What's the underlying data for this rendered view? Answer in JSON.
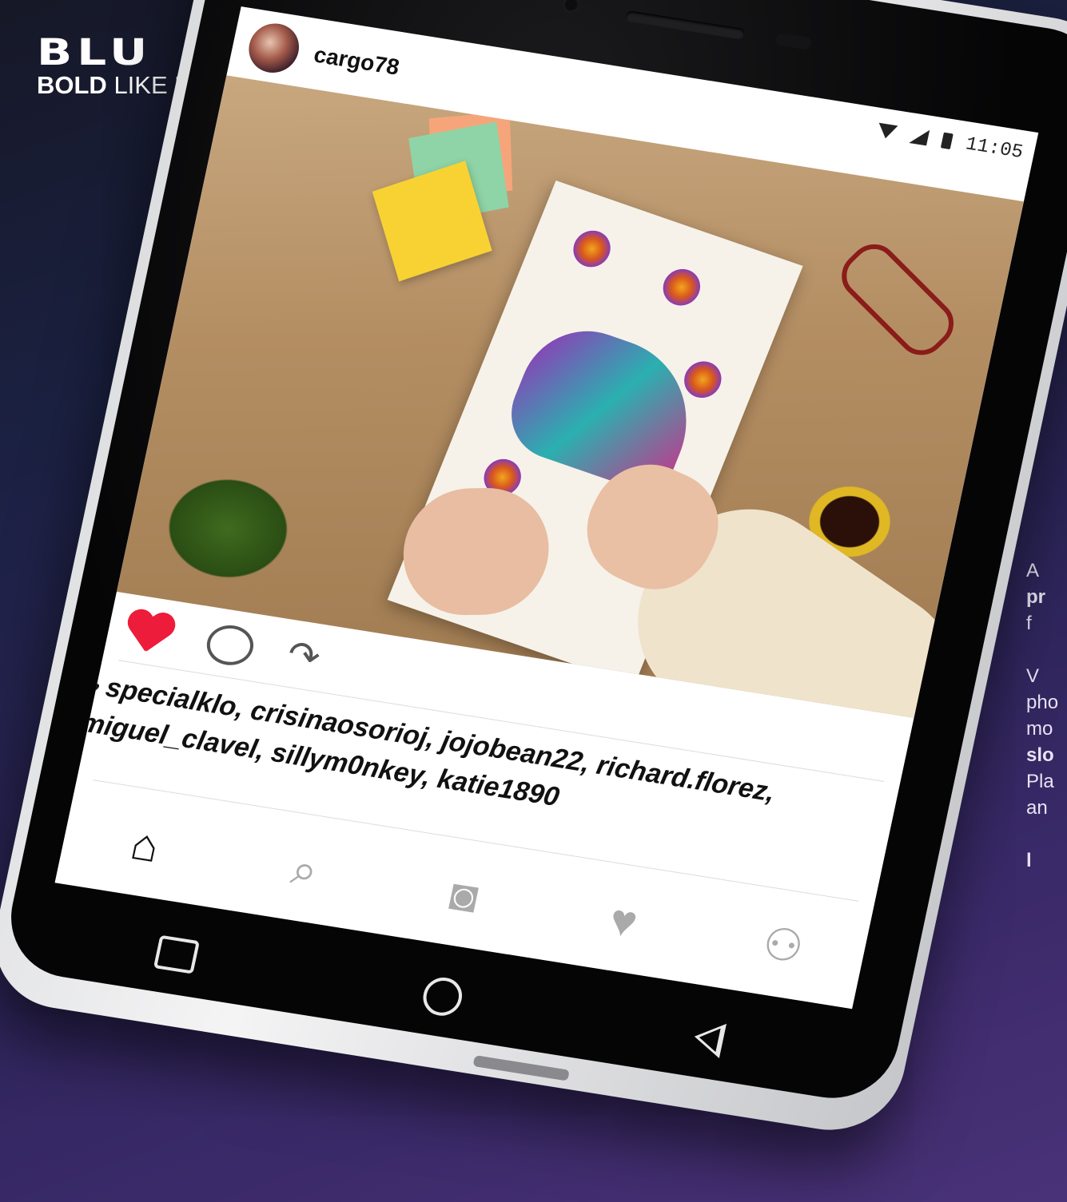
{
  "brand": {
    "name": "BLU",
    "tagline_bold": "BOLD",
    "tagline_rest": " LIKE US",
    "reg": "®"
  },
  "side_copy": [
    "A",
    "pr",
    "f",
    "",
    "V",
    "pho",
    "mo",
    "slo",
    "Pla",
    "an",
    "",
    "l"
  ],
  "status": {
    "time": "11:05"
  },
  "post": {
    "username": "cargo78",
    "likes_line1": "specialklo, crisinaosorioj, jojobean22, richard.florez,",
    "likes_line2": "miguel_clavel, sillym0nkey, katie1890"
  },
  "icons": {
    "like": "heart-icon",
    "comment": "comment-icon",
    "share": "share-icon",
    "tabs": [
      "home-icon",
      "search-icon",
      "camera-icon",
      "heart-icon",
      "profile-icon"
    ],
    "nav": [
      "recents-icon",
      "home-button-icon",
      "back-icon"
    ]
  },
  "colors": {
    "like_red": "#ed1c3a",
    "background_purple": "#3b2a6a"
  }
}
